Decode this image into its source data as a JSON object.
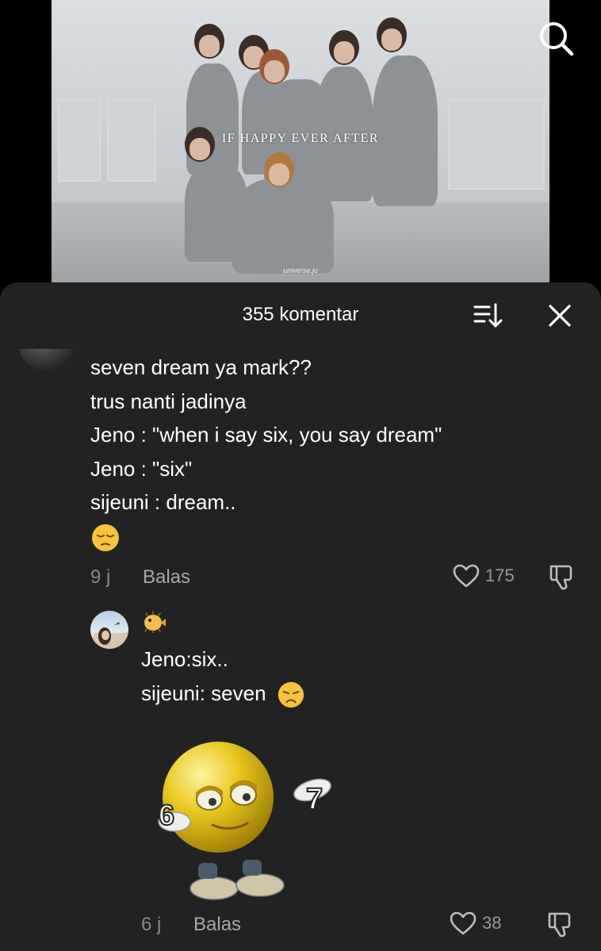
{
  "video": {
    "overlay_title": "IF HAPPY EVER AFTER",
    "watermark": "universe.ju"
  },
  "header": {
    "comment_count": "355 komentar"
  },
  "comments": [
    {
      "lines": [
        "seven dream ya mark??",
        "trus nanti jadinya",
        "Jeno : \"when i say six, you say dream\"",
        "Jeno : \"six\"",
        "sijeuni : dream.."
      ],
      "emoji": "pensive-face",
      "time": "9 j",
      "reply_label": "Balas",
      "likes": "175"
    },
    {
      "name_emoji": "blowfish",
      "lines": [
        "Jeno:six..",
        "sijeuni: seven"
      ],
      "line_emoji": "disappointed-face",
      "sticker": {
        "left_number": "6",
        "right_number": "7"
      },
      "time": "6 j",
      "reply_label": "Balas",
      "likes": "38"
    }
  ],
  "icons": {
    "search": "search-icon",
    "sort": "sort-icon",
    "close": "close-icon",
    "like": "heart-icon",
    "dislike": "thumbs-down-icon"
  },
  "colors": {
    "sheet_background": "#222222",
    "text_primary": "#ffffff",
    "text_secondary": "#8a8a8a"
  }
}
